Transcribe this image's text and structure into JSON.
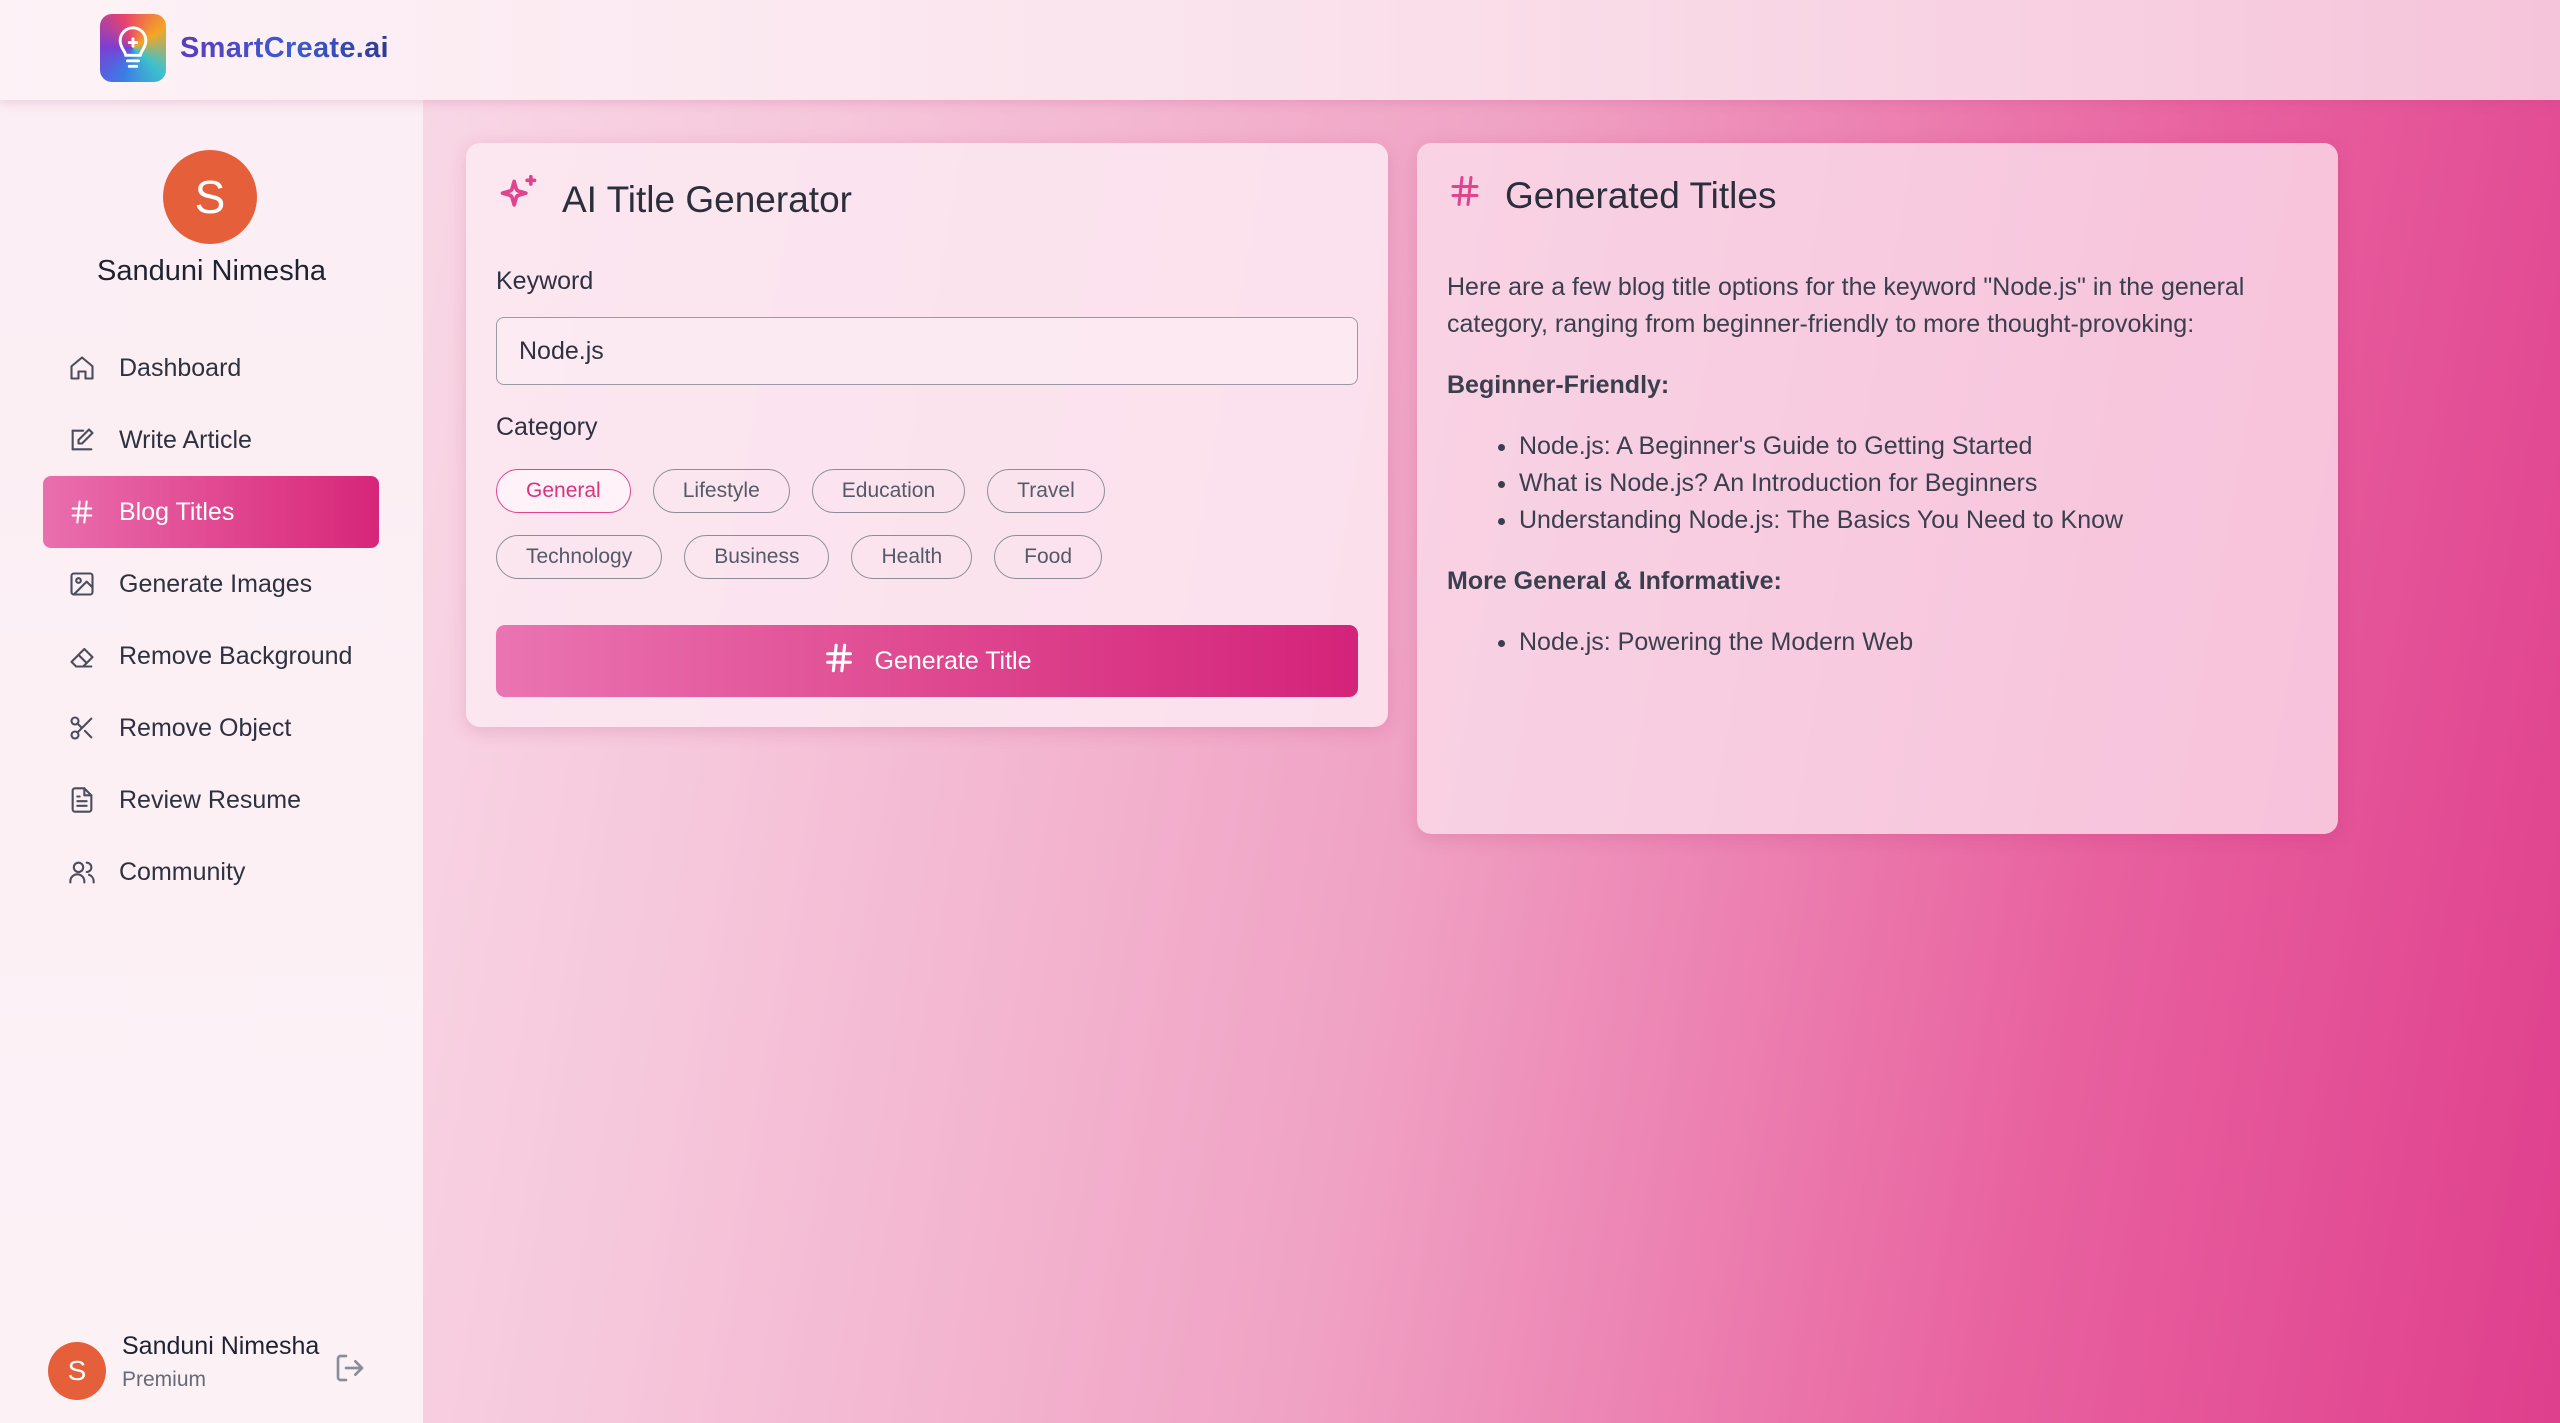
{
  "brand": {
    "name": "SmartCreate.ai"
  },
  "profile": {
    "avatar_letter": "S",
    "name": "Sanduni Nimesha"
  },
  "nav": [
    {
      "label": "Dashboard",
      "icon": "home-icon",
      "active": false
    },
    {
      "label": "Write Article",
      "icon": "edit-icon",
      "active": false
    },
    {
      "label": "Blog Titles",
      "icon": "hash-icon",
      "active": true
    },
    {
      "label": "Generate Images",
      "icon": "image-icon",
      "active": false
    },
    {
      "label": "Remove Background",
      "icon": "eraser-icon",
      "active": false
    },
    {
      "label": "Remove Object",
      "icon": "scissors-icon",
      "active": false
    },
    {
      "label": "Review Resume",
      "icon": "file-text-icon",
      "active": false
    },
    {
      "label": "Community",
      "icon": "users-icon",
      "active": false
    }
  ],
  "footer_user": {
    "avatar_letter": "S",
    "name": "Sanduni Nimesha",
    "plan": "Premium"
  },
  "generator": {
    "title": "AI Title Generator",
    "keyword_label": "Keyword",
    "keyword_value": "Node.js",
    "category_label": "Category",
    "categories_row1": [
      "General",
      "Lifestyle",
      "Education",
      "Travel"
    ],
    "categories_row2": [
      "Technology",
      "Business",
      "Health",
      "Food"
    ],
    "selected_category": "General",
    "button_label": "Generate Title"
  },
  "results": {
    "title": "Generated Titles",
    "intro": "Here are a few blog title options for the keyword \"Node.js\" in the general category, ranging from beginner-friendly to more thought-provoking:",
    "section1": "Beginner-Friendly:",
    "section1_items": [
      "Node.js: A Beginner's Guide to Getting Started",
      "What is Node.js? An Introduction for Beginners",
      "Understanding Node.js: The Basics You Need to Know"
    ],
    "section2": "More General & Informative:",
    "section2_items": [
      "Node.js: Powering the Modern Web"
    ]
  },
  "colors": {
    "accent": "#de3b87",
    "avatar": "#e5603a",
    "brand_text": "#3a5bd1"
  }
}
